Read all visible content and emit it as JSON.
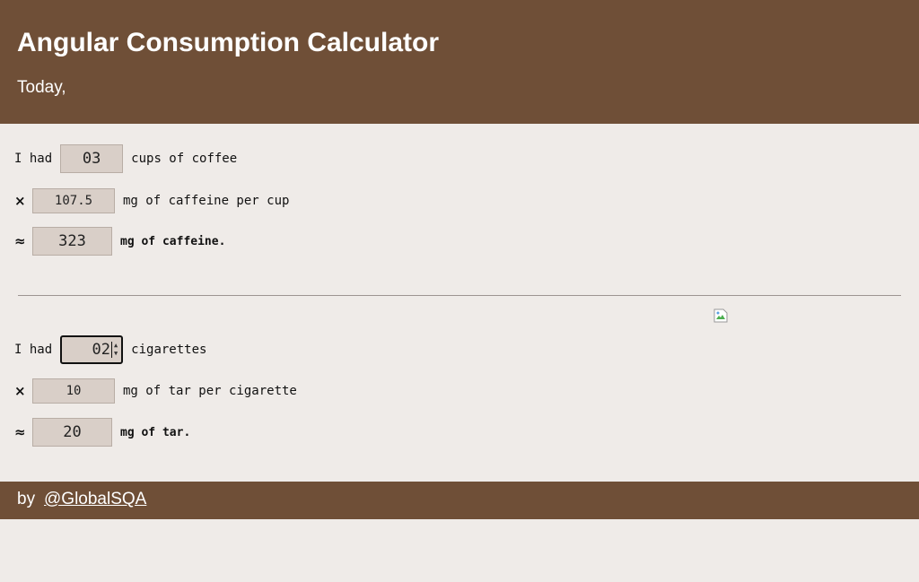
{
  "header": {
    "title": "Angular Consumption Calculator",
    "subtitle": "Today,"
  },
  "coffee": {
    "prefix": "I had",
    "cups_value": "03",
    "cups_label": "cups of coffee",
    "times_symbol": "×",
    "caffeine_per_cup": "107.5",
    "caffeine_per_cup_label": "mg of caffeine per cup",
    "approx_symbol": "≈",
    "total_caffeine": "323",
    "total_label": "mg of caffeine."
  },
  "smoking": {
    "prefix": "I had",
    "cigarettes_value": "02",
    "cigarettes_label": "cigarettes",
    "times_symbol": "×",
    "tar_per_cigarette": "10",
    "tar_per_cigarette_label": "mg of tar per cigarette",
    "approx_symbol": "≈",
    "total_tar": "20",
    "total_label": "mg of tar."
  },
  "icons": {
    "broken_image": "broken-image-icon",
    "spinner_up": "chevron-up-icon",
    "spinner_down": "chevron-down-icon"
  },
  "footer": {
    "by_label": "by",
    "link_text": "@GlobalSQA"
  },
  "colors": {
    "header_bg": "#6f4f37",
    "page_bg": "#efebe8",
    "field_bg": "#d9cfc8"
  }
}
